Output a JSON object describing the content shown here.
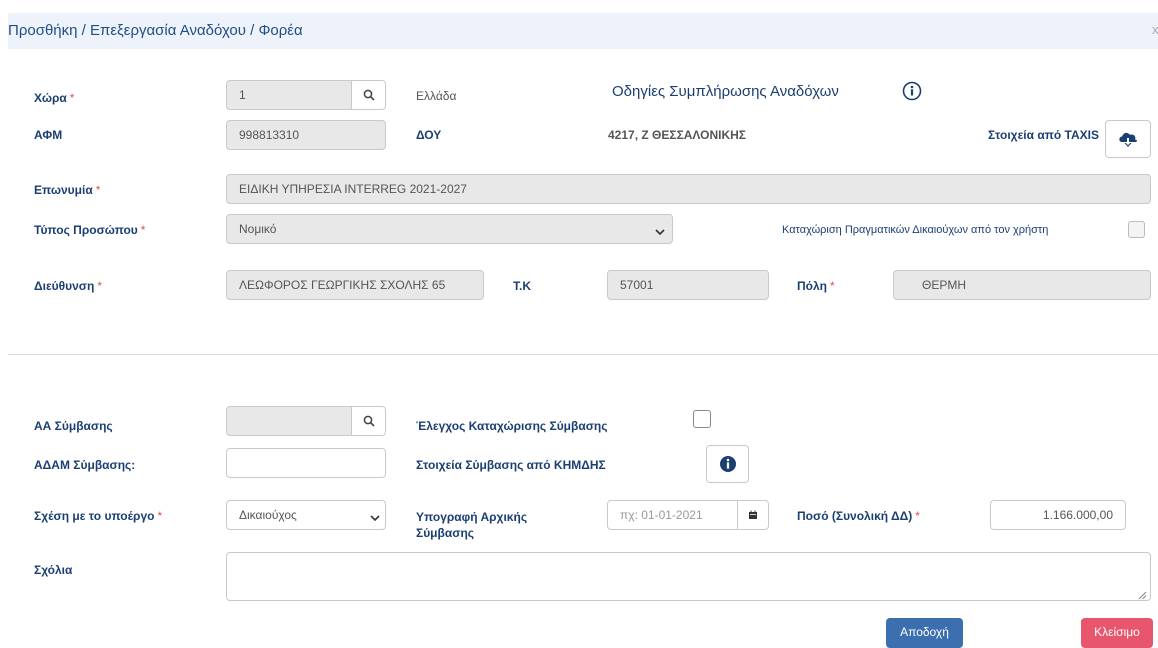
{
  "window": {
    "title": "Προσθήκη / Επεξεργασία Αναδόχου / Φορέα",
    "close_glyph": "x"
  },
  "instructions": {
    "label": "Οδηγίες Συμπλήρωσης Αναδόχων",
    "icon": "info-circle-icon"
  },
  "country": {
    "label": "Χώρα",
    "required": "*",
    "code": "1",
    "name": "Ελλάδα"
  },
  "afm": {
    "label": "ΑΦΜ",
    "value": "998813310"
  },
  "doy": {
    "label": "ΔΟΥ",
    "value": "4217, Ζ ΘΕΣΣΑΛΟΝΙΚΗΣ"
  },
  "taxis": {
    "label": "Στοιχεία από TAXIS",
    "icon": "cloud-download-icon"
  },
  "surname": {
    "label": "Επωνυμία",
    "required": "*",
    "value": "ΕΙΔΙΚΗ ΥΠΗΡΕΣΙΑ INTERREG 2021-2027"
  },
  "person_type": {
    "label": "Τύπος Προσώπου",
    "required": "*",
    "selected": "Νομικό"
  },
  "beneficiaries": {
    "label": "Καταχώριση Πραγματικών Δικαιούχων από τον χρήστη",
    "checked": false
  },
  "address": {
    "label": "Διεύθυνση",
    "required": "*",
    "value": "ΛΕΩΦΟΡΟΣ ΓΕΩΡΓΙΚΗΣ ΣΧΟΛΗΣ 65"
  },
  "postal": {
    "label": "Τ.Κ",
    "value": "57001"
  },
  "city": {
    "label": "Πόλη",
    "required": "*",
    "value": "ΘΕΡΜΗ"
  },
  "contract_no": {
    "label": "ΑΑ Σύμβασης",
    "value": ""
  },
  "contract_check": {
    "label": "Έλεγχος Καταχώρισης Σύμβασης",
    "checked": false
  },
  "adam": {
    "label": "ΑΔΑΜ Σύμβασης:",
    "value": ""
  },
  "kimdis": {
    "label": "Στοιχεία Σύμβασης από ΚΗΜΔΗΣ",
    "icon": "info-circle-icon"
  },
  "relation": {
    "label": "Σχέση με το υποέργο",
    "required": "*",
    "selected": "Δικαιούχος"
  },
  "signature": {
    "label": "Υπογραφή Αρχικής Σύμβασης",
    "placeholder": "πχ: 01-01-2021",
    "icon": "calendar-icon"
  },
  "amount": {
    "label": "Ποσό (Συνολική ΔΔ)",
    "required": "*",
    "value": "1.166.000,00"
  },
  "comments": {
    "label": "Σχόλια",
    "value": ""
  },
  "buttons": {
    "accept": "Αποδοχή",
    "close": "Κλείσιμο"
  },
  "colors": {
    "accept": "#3b6fb0",
    "close": "#e8566e",
    "label": "#1b3f73"
  }
}
